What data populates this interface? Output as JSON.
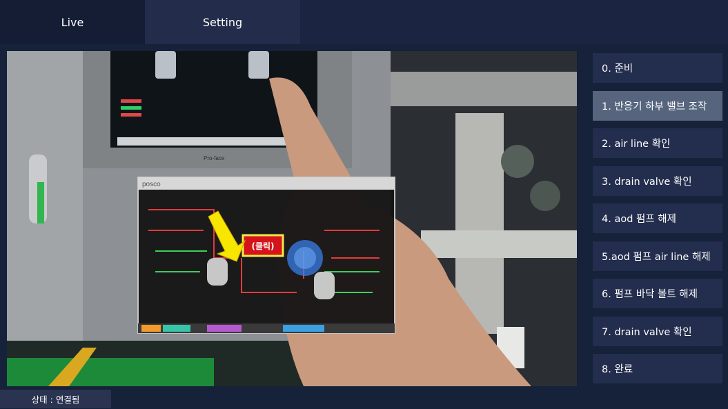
{
  "tabs": [
    {
      "label": "Live",
      "active": true
    },
    {
      "label": "Setting",
      "active": false
    }
  ],
  "steps": [
    {
      "label": "0. 준비",
      "active": false
    },
    {
      "label": "1. 반응기 하부 밸브 조작",
      "active": true
    },
    {
      "label": "2. air line 확인",
      "active": false
    },
    {
      "label": "3. drain valve 확인",
      "active": false
    },
    {
      "label": "4. aod 펌프 해제",
      "active": false
    },
    {
      "label": "5.aod 펌프 air line 해제",
      "active": false
    },
    {
      "label": "6. 펌프 바닥 볼트 해제",
      "active": false
    },
    {
      "label": "7. drain valve 확인",
      "active": false
    },
    {
      "label": "8. 완료",
      "active": false
    }
  ],
  "overlay": {
    "brand": "posco",
    "callout": "(클릭)",
    "panel_brand": "Pro-face"
  },
  "status": {
    "text": "상태 : 연결됨"
  },
  "colors": {
    "background": "#16213a",
    "tab_bar": "#1b2440",
    "step_button": "#232d4d",
    "step_active": "#56647e",
    "callout_fill": "#d4141a",
    "callout_border": "#f4e84a",
    "arrow": "#f6e600"
  }
}
